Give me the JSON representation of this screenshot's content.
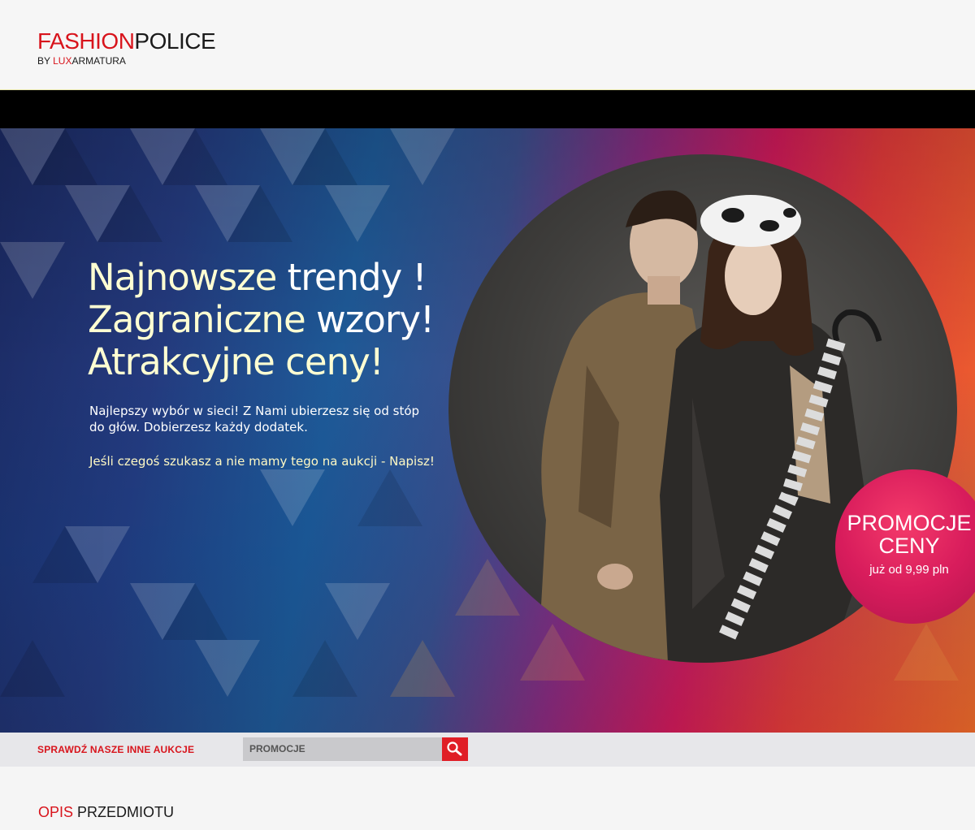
{
  "header": {
    "logo_part1": "FASHION",
    "logo_part2": "POLICE",
    "sub_part1": "BY ",
    "sub_part2": "LUX",
    "sub_part3": "ARMATURA"
  },
  "hero": {
    "line1_a": "Najnowsze",
    "line1_b": " trendy !",
    "line2_a": "Zagraniczne",
    "line2_b": " wzory!",
    "line3": "Atrakcyjne ceny!",
    "description": "Najlepszy wybór w sieci! Z Nami ubierzesz się od stóp do głów. Dobierzesz każdy dodatek.",
    "cta_text": "Jeśli czegoś szukasz a nie mamy tego na aukcji - Napisz!"
  },
  "promo": {
    "line1": "PROMOCJE",
    "line2": "CENY",
    "line3": "już od 9,99 pln"
  },
  "search": {
    "label": "SPRAWDŹ NASZE INNE AUKCJE",
    "value": "PROMOCJE",
    "icon": "search-icon"
  },
  "section": {
    "title_part1": "OPIS",
    "title_part2": " PRZEDMIOTU"
  },
  "colors": {
    "accent": "#d8141c",
    "headline": "#ffffd2"
  }
}
